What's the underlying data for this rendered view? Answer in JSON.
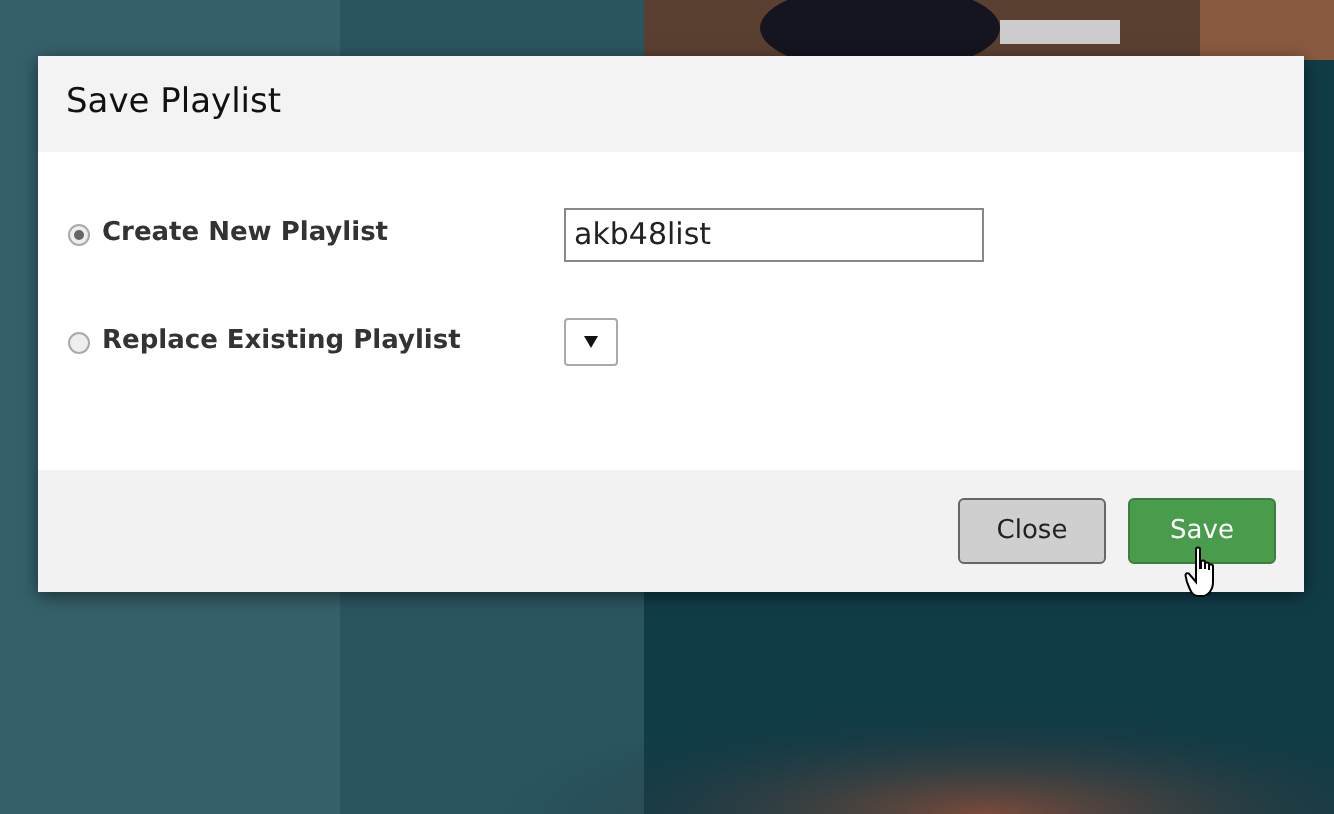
{
  "dialog": {
    "title": "Save Playlist",
    "options": [
      {
        "label": "Create New Playlist",
        "selected": true,
        "kind": "text",
        "value": "akb48list"
      },
      {
        "label": "Replace Existing Playlist",
        "selected": false,
        "kind": "select"
      }
    ],
    "buttons": [
      {
        "label": "Close",
        "kind": "secondary"
      },
      {
        "label": "Save",
        "kind": "primary"
      }
    ]
  }
}
